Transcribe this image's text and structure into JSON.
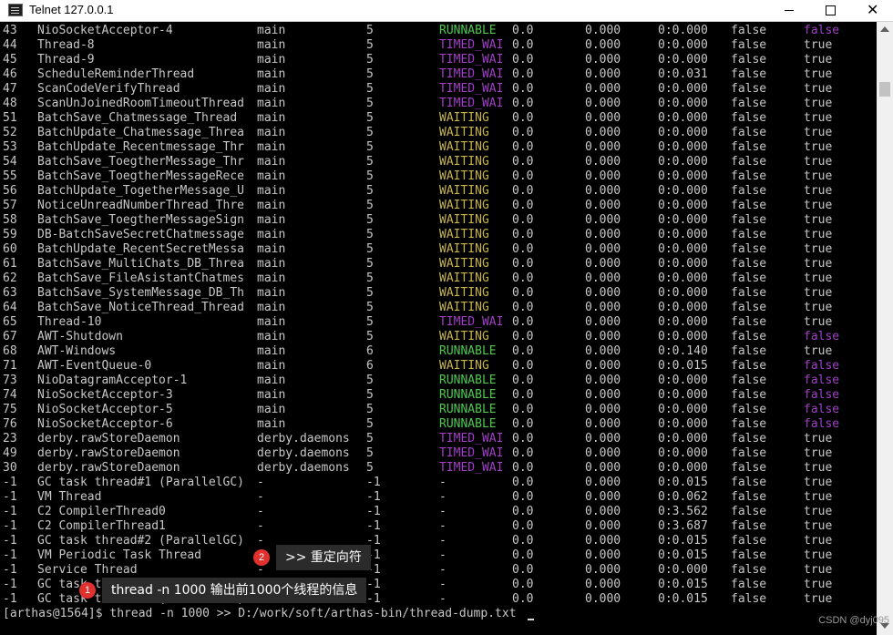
{
  "window": {
    "title": "Telnet 127.0.0.1"
  },
  "colors": {
    "text": "#c8c8c8",
    "running": "#4ec94e",
    "timed": "#a23fc8",
    "waiting": "#c8b54a",
    "false_purple": "#a23fc8",
    "bg": "#000000"
  },
  "threads": [
    {
      "id": "43",
      "name": "NioSocketAcceptor-4",
      "group": "main",
      "priority": "5",
      "state": "RUNNABLE",
      "cpu": "0.0",
      "delta": "0.000",
      "time": "0:0.000",
      "interrupted": "false",
      "daemon": "false"
    },
    {
      "id": "44",
      "name": "Thread-8",
      "group": "main",
      "priority": "5",
      "state": "TIMED_WAI",
      "cpu": "0.0",
      "delta": "0.000",
      "time": "0:0.000",
      "interrupted": "false",
      "daemon": "true"
    },
    {
      "id": "45",
      "name": "Thread-9",
      "group": "main",
      "priority": "5",
      "state": "TIMED_WAI",
      "cpu": "0.0",
      "delta": "0.000",
      "time": "0:0.000",
      "interrupted": "false",
      "daemon": "true"
    },
    {
      "id": "46",
      "name": "ScheduleReminderThread",
      "group": "main",
      "priority": "5",
      "state": "TIMED_WAI",
      "cpu": "0.0",
      "delta": "0.000",
      "time": "0:0.031",
      "interrupted": "false",
      "daemon": "true"
    },
    {
      "id": "47",
      "name": "ScanCodeVerifyThread",
      "group": "main",
      "priority": "5",
      "state": "TIMED_WAI",
      "cpu": "0.0",
      "delta": "0.000",
      "time": "0:0.000",
      "interrupted": "false",
      "daemon": "true"
    },
    {
      "id": "48",
      "name": "ScanUnJoinedRoomTimeoutThread",
      "group": "main",
      "priority": "5",
      "state": "TIMED_WAI",
      "cpu": "0.0",
      "delta": "0.000",
      "time": "0:0.000",
      "interrupted": "false",
      "daemon": "true"
    },
    {
      "id": "51",
      "name": "BatchSave_Chatmessage_Thread",
      "group": "main",
      "priority": "5",
      "state": "WAITING",
      "cpu": "0.0",
      "delta": "0.000",
      "time": "0:0.000",
      "interrupted": "false",
      "daemon": "true"
    },
    {
      "id": "52",
      "name": "BatchUpdate_Chatmessage_Threa",
      "group": "main",
      "priority": "5",
      "state": "WAITING",
      "cpu": "0.0",
      "delta": "0.000",
      "time": "0:0.000",
      "interrupted": "false",
      "daemon": "true"
    },
    {
      "id": "53",
      "name": "BatchUpdate_Recentmessage_Thr",
      "group": "main",
      "priority": "5",
      "state": "WAITING",
      "cpu": "0.0",
      "delta": "0.000",
      "time": "0:0.000",
      "interrupted": "false",
      "daemon": "true"
    },
    {
      "id": "54",
      "name": "BatchSave_ToegtherMessage_Thr",
      "group": "main",
      "priority": "5",
      "state": "WAITING",
      "cpu": "0.0",
      "delta": "0.000",
      "time": "0:0.000",
      "interrupted": "false",
      "daemon": "true"
    },
    {
      "id": "55",
      "name": "BatchSave_ToegtherMessageRece",
      "group": "main",
      "priority": "5",
      "state": "WAITING",
      "cpu": "0.0",
      "delta": "0.000",
      "time": "0:0.000",
      "interrupted": "false",
      "daemon": "true"
    },
    {
      "id": "56",
      "name": "BatchUpdate_TogetherMessage_U",
      "group": "main",
      "priority": "5",
      "state": "WAITING",
      "cpu": "0.0",
      "delta": "0.000",
      "time": "0:0.000",
      "interrupted": "false",
      "daemon": "true"
    },
    {
      "id": "57",
      "name": "NoticeUnreadNumberThread_Thre",
      "group": "main",
      "priority": "5",
      "state": "WAITING",
      "cpu": "0.0",
      "delta": "0.000",
      "time": "0:0.000",
      "interrupted": "false",
      "daemon": "true"
    },
    {
      "id": "58",
      "name": "BatchSave_ToegtherMessageSign",
      "group": "main",
      "priority": "5",
      "state": "WAITING",
      "cpu": "0.0",
      "delta": "0.000",
      "time": "0:0.000",
      "interrupted": "false",
      "daemon": "true"
    },
    {
      "id": "59",
      "name": "DB-BatchSaveSecretChatmessage",
      "group": "main",
      "priority": "5",
      "state": "WAITING",
      "cpu": "0.0",
      "delta": "0.000",
      "time": "0:0.000",
      "interrupted": "false",
      "daemon": "true"
    },
    {
      "id": "60",
      "name": "BatchUpdate_RecentSecretMessa",
      "group": "main",
      "priority": "5",
      "state": "WAITING",
      "cpu": "0.0",
      "delta": "0.000",
      "time": "0:0.000",
      "interrupted": "false",
      "daemon": "true"
    },
    {
      "id": "61",
      "name": "BatchSave_MultiChats_DB_Threa",
      "group": "main",
      "priority": "5",
      "state": "WAITING",
      "cpu": "0.0",
      "delta": "0.000",
      "time": "0:0.000",
      "interrupted": "false",
      "daemon": "true"
    },
    {
      "id": "62",
      "name": "BatchSave_FileAsistantChatmes",
      "group": "main",
      "priority": "5",
      "state": "WAITING",
      "cpu": "0.0",
      "delta": "0.000",
      "time": "0:0.000",
      "interrupted": "false",
      "daemon": "true"
    },
    {
      "id": "63",
      "name": "BatchSave_SystemMessage_DB_Th",
      "group": "main",
      "priority": "5",
      "state": "WAITING",
      "cpu": "0.0",
      "delta": "0.000",
      "time": "0:0.000",
      "interrupted": "false",
      "daemon": "true"
    },
    {
      "id": "64",
      "name": "BatchSave_NoticeThread_Thread",
      "group": "main",
      "priority": "5",
      "state": "WAITING",
      "cpu": "0.0",
      "delta": "0.000",
      "time": "0:0.000",
      "interrupted": "false",
      "daemon": "true"
    },
    {
      "id": "65",
      "name": "Thread-10",
      "group": "main",
      "priority": "5",
      "state": "TIMED_WAI",
      "cpu": "0.0",
      "delta": "0.000",
      "time": "0:0.000",
      "interrupted": "false",
      "daemon": "true"
    },
    {
      "id": "67",
      "name": "AWT-Shutdown",
      "group": "main",
      "priority": "5",
      "state": "WAITING",
      "cpu": "0.0",
      "delta": "0.000",
      "time": "0:0.000",
      "interrupted": "false",
      "daemon": "false"
    },
    {
      "id": "68",
      "name": "AWT-Windows",
      "group": "main",
      "priority": "6",
      "state": "RUNNABLE",
      "cpu": "0.0",
      "delta": "0.000",
      "time": "0:0.140",
      "interrupted": "false",
      "daemon": "true"
    },
    {
      "id": "71",
      "name": "AWT-EventQueue-0",
      "group": "main",
      "priority": "6",
      "state": "WAITING",
      "cpu": "0.0",
      "delta": "0.000",
      "time": "0:0.015",
      "interrupted": "false",
      "daemon": "false"
    },
    {
      "id": "73",
      "name": "NioDatagramAcceptor-1",
      "group": "main",
      "priority": "5",
      "state": "RUNNABLE",
      "cpu": "0.0",
      "delta": "0.000",
      "time": "0:0.000",
      "interrupted": "false",
      "daemon": "false"
    },
    {
      "id": "74",
      "name": "NioSocketAcceptor-3",
      "group": "main",
      "priority": "5",
      "state": "RUNNABLE",
      "cpu": "0.0",
      "delta": "0.000",
      "time": "0:0.000",
      "interrupted": "false",
      "daemon": "false"
    },
    {
      "id": "75",
      "name": "NioSocketAcceptor-5",
      "group": "main",
      "priority": "5",
      "state": "RUNNABLE",
      "cpu": "0.0",
      "delta": "0.000",
      "time": "0:0.000",
      "interrupted": "false",
      "daemon": "false"
    },
    {
      "id": "76",
      "name": "NioSocketAcceptor-6",
      "group": "main",
      "priority": "5",
      "state": "RUNNABLE",
      "cpu": "0.0",
      "delta": "0.000",
      "time": "0:0.000",
      "interrupted": "false",
      "daemon": "false"
    },
    {
      "id": "23",
      "name": "derby.rawStoreDaemon",
      "group": "derby.daemons",
      "priority": "5",
      "state": "TIMED_WAI",
      "cpu": "0.0",
      "delta": "0.000",
      "time": "0:0.000",
      "interrupted": "false",
      "daemon": "true"
    },
    {
      "id": "49",
      "name": "derby.rawStoreDaemon",
      "group": "derby.daemons",
      "priority": "5",
      "state": "TIMED_WAI",
      "cpu": "0.0",
      "delta": "0.000",
      "time": "0:0.000",
      "interrupted": "false",
      "daemon": "true"
    },
    {
      "id": "30",
      "name": "derby.rawStoreDaemon",
      "group": "derby.daemons",
      "priority": "5",
      "state": "TIMED_WAI",
      "cpu": "0.0",
      "delta": "0.000",
      "time": "0:0.000",
      "interrupted": "false",
      "daemon": "true"
    },
    {
      "id": "-1",
      "name": "GC task thread#1 (ParallelGC)",
      "group": "-",
      "priority": "-1",
      "state": "-",
      "cpu": "0.0",
      "delta": "0.000",
      "time": "0:0.015",
      "interrupted": "false",
      "daemon": "true"
    },
    {
      "id": "-1",
      "name": "VM Thread",
      "group": "-",
      "priority": "-1",
      "state": "-",
      "cpu": "0.0",
      "delta": "0.000",
      "time": "0:0.062",
      "interrupted": "false",
      "daemon": "true"
    },
    {
      "id": "-1",
      "name": "C2 CompilerThread0",
      "group": "-",
      "priority": "-1",
      "state": "-",
      "cpu": "0.0",
      "delta": "0.000",
      "time": "0:3.562",
      "interrupted": "false",
      "daemon": "true"
    },
    {
      "id": "-1",
      "name": "C2 CompilerThread1",
      "group": "-",
      "priority": "-1",
      "state": "-",
      "cpu": "0.0",
      "delta": "0.000",
      "time": "0:3.687",
      "interrupted": "false",
      "daemon": "true"
    },
    {
      "id": "-1",
      "name": "GC task thread#2 (ParallelGC)",
      "group": "-",
      "priority": "-1",
      "state": "-",
      "cpu": "0.0",
      "delta": "0.000",
      "time": "0:0.015",
      "interrupted": "false",
      "daemon": "true"
    },
    {
      "id": "-1",
      "name": "VM Periodic Task Thread",
      "group": "-",
      "priority": "-1",
      "state": "-",
      "cpu": "0.0",
      "delta": "0.000",
      "time": "0:0.015",
      "interrupted": "false",
      "daemon": "true"
    },
    {
      "id": "-1",
      "name": "Service Thread",
      "group": "-",
      "priority": "-1",
      "state": "-",
      "cpu": "0.0",
      "delta": "0.000",
      "time": "0:0.000",
      "interrupted": "false",
      "daemon": "true"
    },
    {
      "id": "-1",
      "name": "GC task thread#0 (ParallelGC)",
      "group": "-",
      "priority": "-1",
      "state": "-",
      "cpu": "0.0",
      "delta": "0.000",
      "time": "0:0.015",
      "interrupted": "false",
      "daemon": "true"
    },
    {
      "id": "-1",
      "name": "GC task thread#3 (ParallelGC)",
      "group": "-",
      "priority": "-1",
      "state": "-",
      "cpu": "0.0",
      "delta": "0.000",
      "time": "0:0.015",
      "interrupted": "false",
      "daemon": "true"
    }
  ],
  "prompt": "[arthas@1564]$ thread -n 1000 >> D:/work/soft/arthas-bin/thread-dump.txt",
  "annotations": [
    {
      "number": "2",
      "text": ">> 重定向符"
    },
    {
      "number": "1",
      "text": "thread -n 1000 输出前1000个线程的信息"
    }
  ],
  "watermark": "CSDN @dyj095"
}
